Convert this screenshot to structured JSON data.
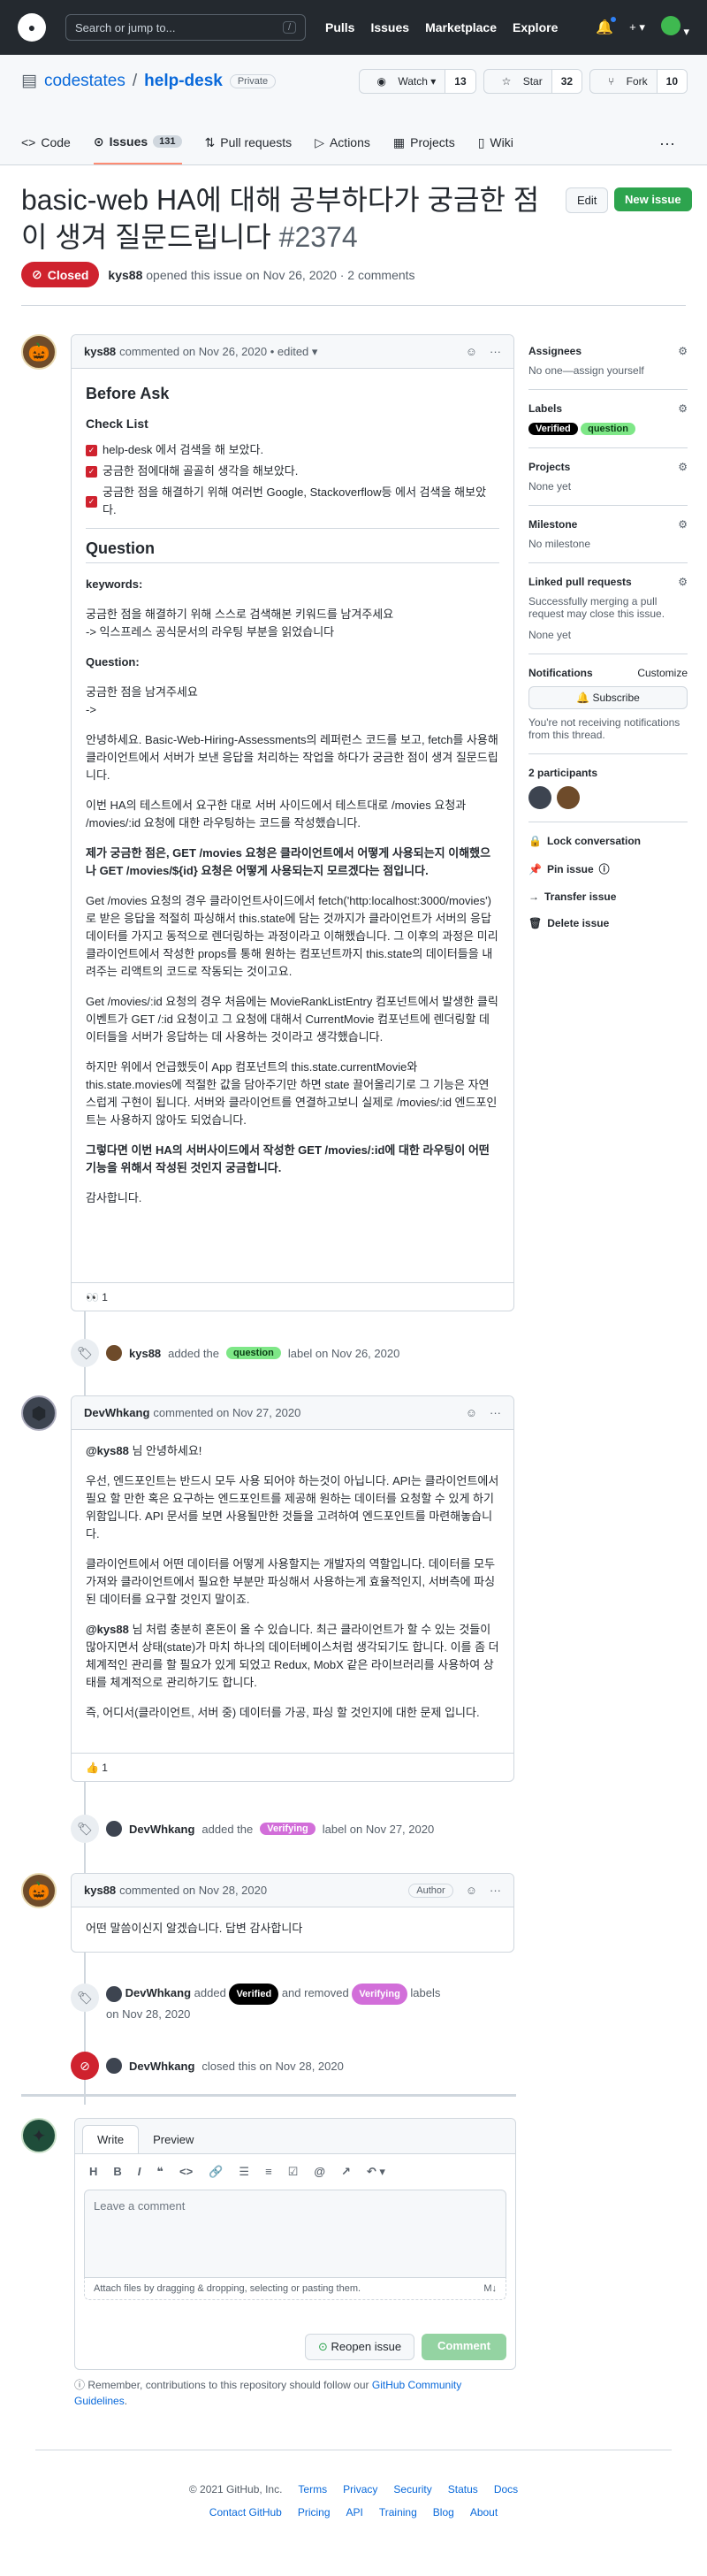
{
  "topbar": {
    "search_placeholder": "Search or jump to...",
    "slash": "/",
    "nav": [
      "Pulls",
      "Issues",
      "Marketplace",
      "Explore"
    ],
    "plus": "+ ▾"
  },
  "repo": {
    "owner": "codestates",
    "name": "help-desk",
    "visibility": "Private",
    "watch_label": "Watch",
    "watch_count": "13",
    "star_label": "Star",
    "star_count": "32",
    "fork_label": "Fork",
    "fork_count": "10",
    "tabs": [
      {
        "label": "Code"
      },
      {
        "label": "Issues",
        "count": "131"
      },
      {
        "label": "Pull requests"
      },
      {
        "label": "Actions"
      },
      {
        "label": "Projects"
      },
      {
        "label": "Wiki"
      }
    ]
  },
  "issue": {
    "title": "basic-web HA에 대해 공부하다가 궁금한 점이 생겨 질문드립니다",
    "number": "#2374",
    "edit_label": "Edit",
    "new_issue_label": "New issue",
    "state": "Closed",
    "author": "kys88",
    "opened_text": "opened this issue on Nov 26, 2020 · 2 comments"
  },
  "first_comment": {
    "author": "kys88",
    "meta": "commented on Nov 26, 2020 • edited ▾",
    "before_ask": "Before Ask",
    "checklist_title": "Check List",
    "checklist": [
      "help-desk 에서 검색을 해 보았다.",
      "궁금한 점에대해 골골히 생각을 해보았다.",
      "궁금한 점을 해결하기 위해 여러번 Google, Stackoverflow등 에서 검색을 해보았다."
    ],
    "question_heading": "Question",
    "keywords_label": "keywords:",
    "keywords_text1": "궁금한 점을 해결하기 위해 스스로 검색해본 키워드를 남겨주세요",
    "keywords_text2": "-> 익스프레스 공식문서의 라우팅 부분을 읽었습니다",
    "question_label": "Question:",
    "question_text1": "궁금한 점을 남겨주세요",
    "question_text2": "->",
    "p1": "안녕하세요. Basic-Web-Hiring-Assessments의 레퍼런스 코드를 보고, fetch를 사용해 클라이언트에서 서버가 보낸 응답을 처리하는 작업을 하다가 궁금한 점이 생겨 질문드립니다.",
    "p2": "이번 HA의 테스트에서 요구한 대로 서버 사이드에서 테스트대로 /movies 요청과 /movies/:id 요청에 대한 라우팅하는 코드를 작성했습니다.",
    "p3": "제가 궁금한 점은, GET /movies 요청은 클라이언트에서 어떻게 사용되는지 이해했으나 GET /movies/${id} 요청은 어떻게 사용되는지 모르겠다는 점입니다.",
    "p4": "Get /movies 요청의 경우 클라이언트사이드에서 fetch('http:localhost:3000/movies')로 받은 응답을 적절히 파싱해서 this.state에 담는 것까지가 클라이언트가 서버의 응답 데이터를 가지고 동적으로 렌더링하는 과정이라고 이해했습니다. 그 이후의 과정은 미리 클라이언트에서 작성한 props를 통해 원하는 컴포넌트까지 this.state의 데이터들을 내려주는 리액트의 코드로 작동되는 것이고요.",
    "p5": "Get /movies/:id 요청의 경우 처음에는 MovieRankListEntry 컴포넌트에서 발생한 클릭이벤트가 GET /:id 요청이고 그 요청에 대해서 CurrentMovie 컴포넌트에 렌더링할 데이터들을 서버가 응답하는 데 사용하는 것이라고 생각했습니다.",
    "p6": "하지만 위에서 언급했듯이 App 컴포넌트의 this.state.currentMovie와 this.state.movies에 적절한 값을 담아주기만 하면 state 끌어올리기로 그 기능은 자연스럽게 구현이 됩니다. 서버와 클라이언트를 연결하고보니 실제로 /movies/:id 엔드포인트는 사용하지 않아도 되었습니다.",
    "p7": "그렇다면 이번 HA의 서버사이드에서 작성한 GET /movies/:id에 대한 라우팅이 어떤 기능을 위해서 작성된 것인지 궁금합니다.",
    "p8": "감사합니다.",
    "reaction": "👀 1"
  },
  "event1": {
    "actor": "kys88",
    "pre": "added the",
    "label": "question",
    "post": "label on Nov 26, 2020"
  },
  "second_comment": {
    "author": "DevWhkang",
    "meta": "commented on Nov 27, 2020",
    "greet_mention": "@kys88",
    "greet_rest": " 님 안녕하세요!",
    "p1": "우선, 엔드포인트는 반드시 모두 사용 되어야 하는것이 아닙니다. API는 클라이언트에서 필요 할 만한 혹은 요구하는 엔드포인트를 제공해 원하는 데이터를 요청할 수 있게 하기 위함입니다. API 문서를 보면 사용될만한 것들을 고려하여 엔드포인트를 마련해놓습니다.",
    "p2": "클라이언트에서 어떤 데이터를 어떻게 사용할지는 개발자의 역할입니다. 데이터를 모두 가져와 클라이언트에서 필요한 부분만 파싱해서 사용하는게 효율적인지, 서버측에 파싱된 데이터를 요구할 것인지 말이죠.",
    "p3_mention": "@kys88",
    "p3_rest": " 님 처럼 충분히 혼돈이 올 수 있습니다. 최근 클라이언트가 할 수 있는 것들이 많아지면서 상태(state)가 마치 하나의 데이터베이스처럼 생각되기도 합니다. 이를 좀 더 체계적인 관리를 할 필요가 있게 되었고 Redux, MobX 같은 라이브러리를 사용하여 상태를 체계적으로 관리하기도 합니다.",
    "p4": "즉, 어디서(클라이언트, 서버 중) 데이터를 가공, 파싱 할 것인지에 대한 문제 입니다.",
    "reaction": "👍 1"
  },
  "event2": {
    "actor": "DevWhkang",
    "pre": "added the",
    "label": "Verifying",
    "post": "label on Nov 27, 2020"
  },
  "third_comment": {
    "author": "kys88",
    "meta": "commented on Nov 28, 2020",
    "badge": "Author",
    "text": "어떤 말씀이신지 알겠습니다. 답변 감사합니다"
  },
  "event3": {
    "actor": "DevWhkang",
    "pre": "added",
    "label_added": "Verified",
    "mid": "and removed",
    "label_removed": "Verifying",
    "post": "labels",
    "date": "on Nov 28, 2020"
  },
  "event4": {
    "actor": "DevWhkang",
    "text": "closed this on Nov 28, 2020"
  },
  "sidebar": {
    "assignees_title": "Assignees",
    "assignees_value": "No one—assign yourself",
    "labels_title": "Labels",
    "labels": [
      "Verified",
      "question"
    ],
    "projects_title": "Projects",
    "projects_value": "None yet",
    "milestone_title": "Milestone",
    "milestone_value": "No milestone",
    "linked_title": "Linked pull requests",
    "linked_text": "Successfully merging a pull request may close this issue.",
    "linked_value": "None yet",
    "notif_title": "Notifications",
    "notif_customize": "Customize",
    "subscribe_label": "Subscribe",
    "notif_text": "You're not receiving notifications from this thread.",
    "participants_title": "2 participants",
    "lock": "Lock conversation",
    "pin": "Pin issue",
    "transfer": "Transfer issue",
    "delete": "Delete issue"
  },
  "editor": {
    "write_tab": "Write",
    "preview_tab": "Preview",
    "placeholder": "Leave a comment",
    "attach_text": "Attach files by dragging & dropping, selecting or pasting them.",
    "md": "M↓",
    "reopen_label": "Reopen issue",
    "comment_label": "Comment"
  },
  "note": {
    "text": "Remember, contributions to this repository should follow our ",
    "link": "GitHub Community Guidelines",
    "end": "."
  },
  "footer": {
    "copyright": "© 2021 GitHub, Inc.",
    "row1": [
      "Terms",
      "Privacy",
      "Security",
      "Status",
      "Docs"
    ],
    "row2": [
      "Contact GitHub",
      "Pricing",
      "API",
      "Training",
      "Blog",
      "About"
    ]
  }
}
